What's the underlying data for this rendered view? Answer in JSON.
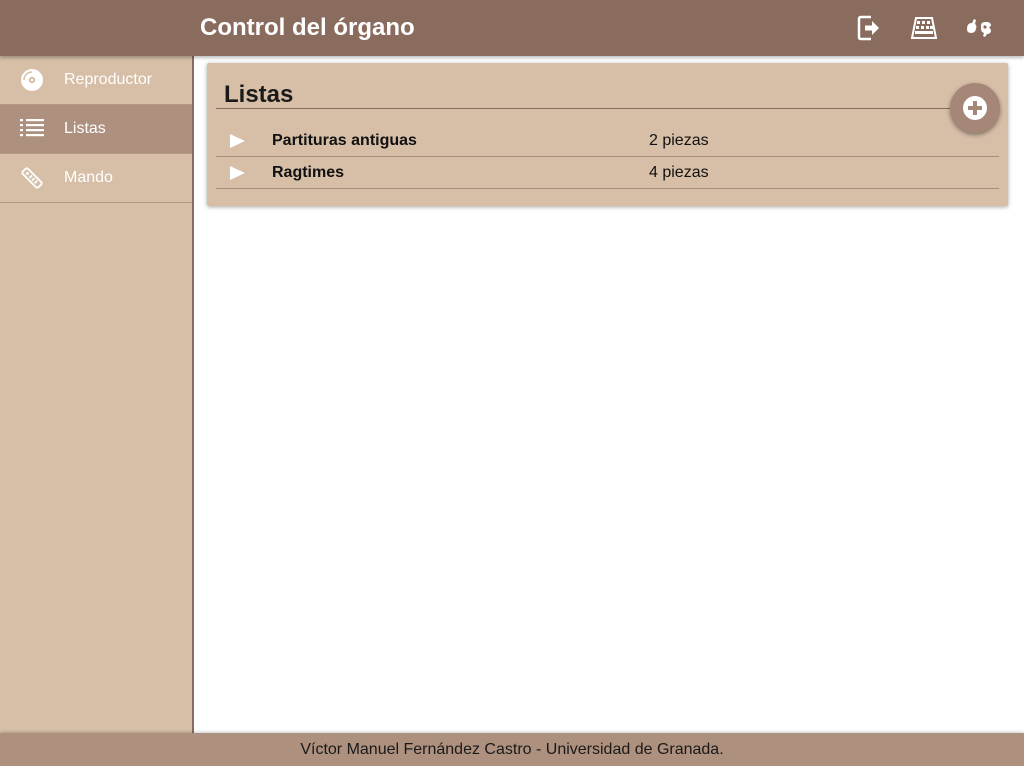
{
  "app": {
    "title": "Control del órgano"
  },
  "header_actions": [
    {
      "icon": "exit-icon"
    },
    {
      "icon": "keyboard-icon"
    },
    {
      "icon": "sign-language-icon"
    }
  ],
  "sidebar": {
    "items": [
      {
        "label": "Reproductor",
        "icon": "disc-icon",
        "active": false
      },
      {
        "label": "Listas",
        "icon": "list-icon",
        "active": true
      },
      {
        "label": "Mando",
        "icon": "remote-control-icon",
        "active": false
      }
    ]
  },
  "main": {
    "title": "Listas",
    "add_icon": "plus-circle-icon",
    "lists": [
      {
        "name": "Partituras antiguas",
        "count": "2 piezas",
        "icon": "play-icon"
      },
      {
        "name": "Ragtimes",
        "count": "4 piezas",
        "icon": "play-icon"
      }
    ]
  },
  "footer": {
    "text": "Víctor Manuel Fernández Castro - Universidad de Granada."
  },
  "colors": {
    "header": "#8a6c5e",
    "sidebar": "#d6bea7",
    "sidebar_active": "#ad907e",
    "card": "#d6bea7",
    "footer": "#ad907e",
    "fab": "#a48777"
  }
}
